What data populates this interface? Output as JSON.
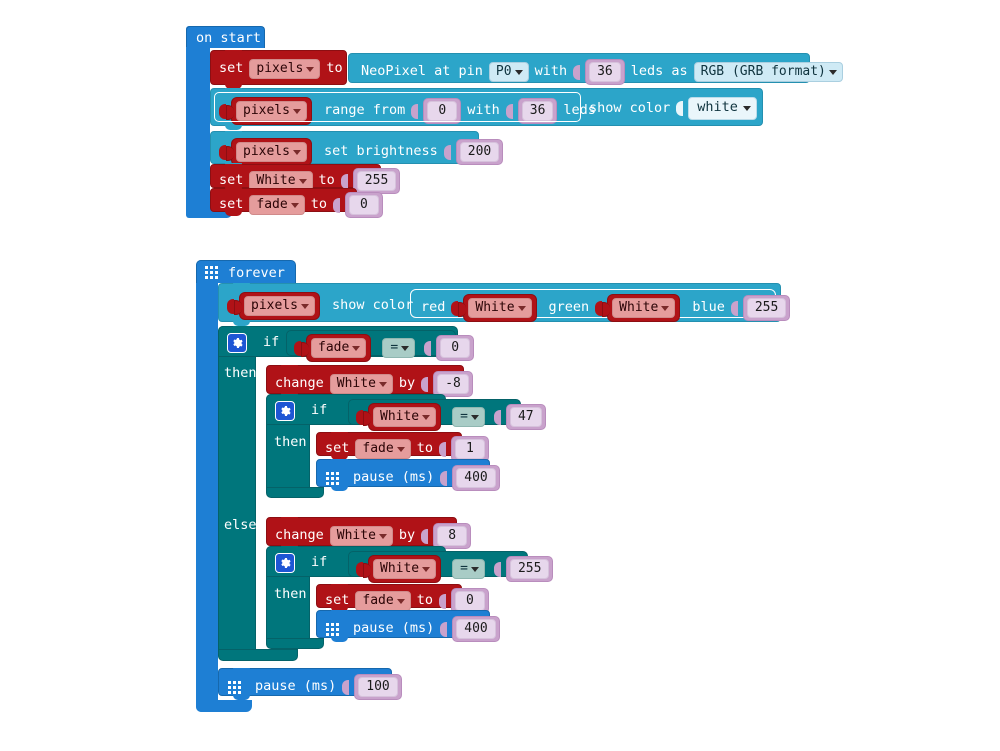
{
  "editor": {
    "kind": "makecode-blocks-workspace",
    "background": "#ffffff"
  },
  "colors": {
    "event_blue": "#1E7FD4",
    "neopixel_teal": "#2CA5C9",
    "logic_teal_dark": "#00767C",
    "variables_red": "#B01217",
    "variable_pill": "#E59C9C",
    "number_mauve": "#C9A2CC",
    "number_field": "#E7D7EC",
    "logic_dropdown": "#A9CCC6",
    "dropdown_light": "#CFEAF5"
  },
  "scripts": [
    {
      "id": "on-start-script",
      "hat": {
        "label": "on start",
        "icon": "none"
      },
      "statements": [
        {
          "id": "set-pixels",
          "kind": "variables-set",
          "parts": [
            "set",
            "pixels",
            "to"
          ],
          "set_label": "set",
          "variable": "pixels",
          "to_label": "to",
          "value": {
            "kind": "neopixel-create",
            "text_1": "NeoPixel at pin",
            "pin": "P0",
            "text_2": "with",
            "count": "36",
            "text_3": "leds as",
            "mode": "RGB (GRB format)"
          }
        },
        {
          "id": "pixels-range-show-color",
          "kind": "neopixel-range-show",
          "variable": "pixels",
          "text_1": "range from",
          "from": "0",
          "text_2": "with",
          "count": "36",
          "text_3": "leds",
          "text_4": "show color",
          "color": "white"
        },
        {
          "id": "pixels-set-brightness",
          "kind": "neopixel-brightness",
          "variable": "pixels",
          "text_1": "set brightness",
          "brightness": "200"
        },
        {
          "id": "set-white-255",
          "kind": "variables-set",
          "set_label": "set",
          "variable": "White",
          "to_label": "to",
          "number": "255"
        },
        {
          "id": "set-fade-0",
          "kind": "variables-set",
          "set_label": "set",
          "variable": "fade",
          "to_label": "to",
          "number": "0"
        }
      ]
    },
    {
      "id": "forever-script",
      "hat": {
        "label": "forever",
        "icon": "grid-icon"
      },
      "statements": [
        {
          "id": "pixels-show-color-rgb",
          "kind": "neopixel-show-color",
          "variable": "pixels",
          "text_1": "show color",
          "rgb": {
            "red_label": "red",
            "red_value": "White",
            "green_label": "green",
            "green_value": "White",
            "blue_label": "blue",
            "blue_value": "255"
          }
        },
        {
          "id": "if-fade-equals-0",
          "kind": "logic-if-else",
          "if_label": "if",
          "then_label": "then",
          "else_label": "else",
          "condition": {
            "left": "fade",
            "op": "=",
            "right": "0"
          },
          "then_branch": [
            {
              "id": "change-white-by-minus8",
              "kind": "variables-change",
              "change_label": "change",
              "variable": "White",
              "by_label": "by",
              "number": "-8"
            },
            {
              "id": "if-white-equals-47",
              "kind": "logic-if",
              "if_label": "if",
              "then_label": "then",
              "condition": {
                "left": "White",
                "op": "=",
                "right": "47"
              },
              "then_branch": [
                {
                  "id": "set-fade-1",
                  "kind": "variables-set",
                  "set_label": "set",
                  "variable": "fade",
                  "to_label": "to",
                  "number": "1"
                },
                {
                  "id": "pause-400-a",
                  "kind": "basic-pause",
                  "icon": "grid-icon",
                  "label": "pause (ms)",
                  "number": "400"
                }
              ]
            }
          ],
          "else_branch": [
            {
              "id": "change-white-by-8",
              "kind": "variables-change",
              "change_label": "change",
              "variable": "White",
              "by_label": "by",
              "number": "8"
            },
            {
              "id": "if-white-equals-255",
              "kind": "logic-if",
              "if_label": "if",
              "then_label": "then",
              "condition": {
                "left": "White",
                "op": "=",
                "right": "255"
              },
              "then_branch": [
                {
                  "id": "set-fade-0b",
                  "kind": "variables-set",
                  "set_label": "set",
                  "variable": "fade",
                  "to_label": "to",
                  "number": "0"
                },
                {
                  "id": "pause-400-b",
                  "kind": "basic-pause",
                  "icon": "grid-icon",
                  "label": "pause (ms)",
                  "number": "400"
                }
              ]
            }
          ]
        },
        {
          "id": "pause-100",
          "kind": "basic-pause",
          "icon": "grid-icon",
          "label": "pause (ms)",
          "number": "100"
        }
      ]
    }
  ]
}
